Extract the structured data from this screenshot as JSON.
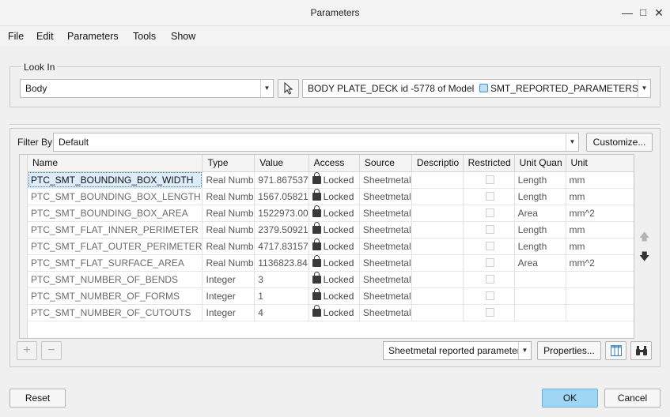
{
  "window": {
    "title": "Parameters"
  },
  "menu": [
    "File",
    "Edit",
    "Parameters",
    "Tools",
    "Show"
  ],
  "look_in": {
    "label": "Look In",
    "scope": "Body",
    "model_prefix": "BODY PLATE_DECK id -5778 of Model",
    "model_name": "SMT_REPORTED_PARAMETERS"
  },
  "filter": {
    "label": "Filter By",
    "value": "Default",
    "customize_label": "Customize..."
  },
  "table": {
    "columns": [
      "Name",
      "Type",
      "Value",
      "Access",
      "Source",
      "Descriptio",
      "Restricted",
      "Unit Quan",
      "Unit"
    ],
    "rows": [
      {
        "name": "PTC_SMT_BOUNDING_BOX_WIDTH",
        "type": "Real Numb",
        "value": "971.867537",
        "access": "Locked",
        "source": "Sheetmetal",
        "unit_quantity": "Length",
        "unit": "mm"
      },
      {
        "name": "PTC_SMT_BOUNDING_BOX_LENGTH",
        "type": "Real Numb",
        "value": "1567.05821",
        "access": "Locked",
        "source": "Sheetmetal",
        "unit_quantity": "Length",
        "unit": "mm"
      },
      {
        "name": "PTC_SMT_BOUNDING_BOX_AREA",
        "type": "Real Numb",
        "value": "1522973.00",
        "access": "Locked",
        "source": "Sheetmetal",
        "unit_quantity": "Area",
        "unit": "mm^2"
      },
      {
        "name": "PTC_SMT_FLAT_INNER_PERIMETER",
        "type": "Real Numb",
        "value": "2379.50921",
        "access": "Locked",
        "source": "Sheetmetal",
        "unit_quantity": "Length",
        "unit": "mm"
      },
      {
        "name": "PTC_SMT_FLAT_OUTER_PERIMETER",
        "type": "Real Numb",
        "value": "4717.83157",
        "access": "Locked",
        "source": "Sheetmetal",
        "unit_quantity": "Length",
        "unit": "mm"
      },
      {
        "name": "PTC_SMT_FLAT_SURFACE_AREA",
        "type": "Real Numb",
        "value": "1136823.84",
        "access": "Locked",
        "source": "Sheetmetal",
        "unit_quantity": "Area",
        "unit": "mm^2"
      },
      {
        "name": "PTC_SMT_NUMBER_OF_BENDS",
        "type": "Integer",
        "value": "3",
        "access": "Locked",
        "source": "Sheetmetal",
        "unit_quantity": "",
        "unit": ""
      },
      {
        "name": "PTC_SMT_NUMBER_OF_FORMS",
        "type": "Integer",
        "value": "1",
        "access": "Locked",
        "source": "Sheetmetal",
        "unit_quantity": "",
        "unit": ""
      },
      {
        "name": "PTC_SMT_NUMBER_OF_CUTOUTS",
        "type": "Integer",
        "value": "4",
        "access": "Locked",
        "source": "Sheetmetal",
        "unit_quantity": "",
        "unit": ""
      }
    ]
  },
  "bottom": {
    "param_set": "Sheetmetal reported parameters",
    "properties_label": "Properties...",
    "reset_label": "Reset",
    "ok_label": "OK",
    "cancel_label": "Cancel"
  }
}
